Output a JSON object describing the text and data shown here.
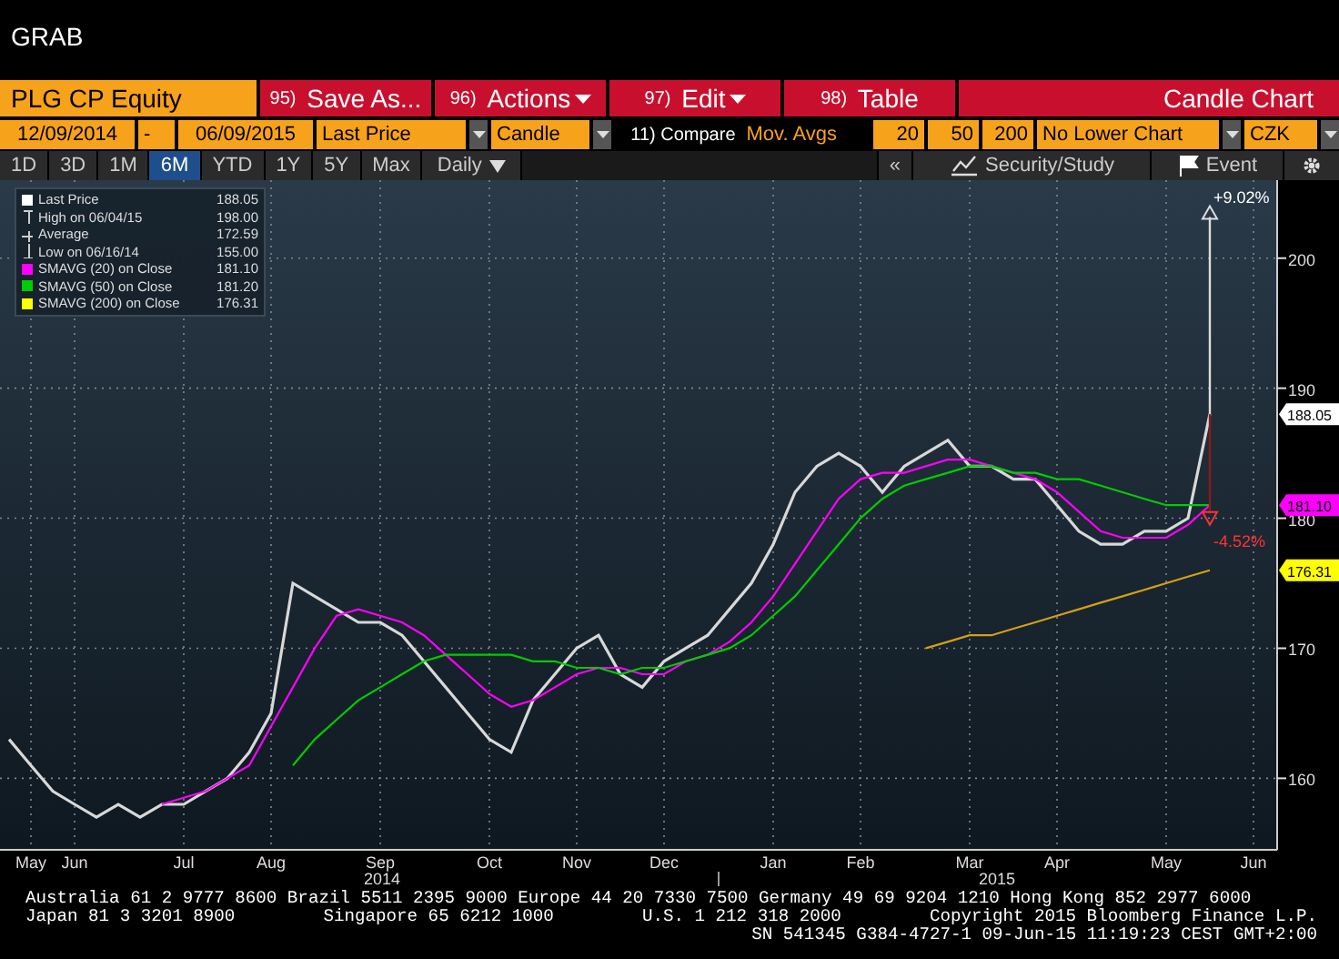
{
  "window": {
    "title": "GRAB"
  },
  "toolbar": {
    "security": "PLG CP Equity",
    "buttons": [
      {
        "number": "95)",
        "label": "Save As...",
        "dropdown": false
      },
      {
        "number": "96)",
        "label": "Actions",
        "dropdown": true
      },
      {
        "number": "97)",
        "label": "Edit",
        "dropdown": true
      },
      {
        "number": "98)",
        "label": "Table",
        "dropdown": false
      }
    ],
    "chart_type_title": "Candle Chart"
  },
  "settings": {
    "start_date": "12/09/2014",
    "separator": "-",
    "end_date": "06/09/2015",
    "field": "Last Price",
    "style": "Candle",
    "compare": "11) Compare",
    "mov_avgs_label": "Mov. Avgs",
    "mov_avgs": [
      "20",
      "50",
      "200"
    ],
    "lower_chart": "No Lower Chart",
    "currency": "CZK"
  },
  "periods": [
    {
      "label": "1D",
      "selected": false
    },
    {
      "label": "3D",
      "selected": false
    },
    {
      "label": "1M",
      "selected": false
    },
    {
      "label": "6M",
      "selected": true
    },
    {
      "label": "YTD",
      "selected": false
    },
    {
      "label": "1Y",
      "selected": false
    },
    {
      "label": "5Y",
      "selected": false
    },
    {
      "label": "Max",
      "selected": false
    }
  ],
  "frequency": "Daily",
  "right_tools": {
    "collapse": "«",
    "study": "Security/Study",
    "event": "Event"
  },
  "chart": {
    "legend": [
      {
        "kind": "square",
        "label": "Last Price",
        "value": "188.05",
        "color": "#ffffff"
      },
      {
        "kind": "high",
        "label": "High on 06/04/15",
        "value": "198.00"
      },
      {
        "kind": "average",
        "label": "Average",
        "value": "172.59"
      },
      {
        "kind": "low",
        "label": "Low on 06/16/14",
        "value": "155.00"
      },
      {
        "kind": "square",
        "label": "SMAVG (20) on Close",
        "value": "181.10",
        "color": "#ff00ff"
      },
      {
        "kind": "square",
        "label": "SMAVG (50) on Close",
        "value": "181.20",
        "color": "#00cc00"
      },
      {
        "kind": "square",
        "label": "SMAVG (200) on Close",
        "value": "176.31",
        "color": "#ffff00"
      }
    ],
    "year_labels": [
      "2014",
      "2015"
    ],
    "percent_labels": [
      {
        "text": "+9.02%",
        "color": "#ffffff"
      },
      {
        "text": "-4.52%",
        "color": "#ff3333"
      }
    ],
    "value_tags": [
      {
        "text": "188.05",
        "color": "#ffffff"
      },
      {
        "text": "181.10",
        "color": "#ff00ff"
      },
      {
        "text": "176.31",
        "color": "#ffff00"
      }
    ],
    "chart_data": {
      "type": "line",
      "categories": [
        null,
        "May",
        null,
        "Jun",
        null,
        null,
        null,
        null,
        "Jul",
        null,
        null,
        null,
        "Aug",
        null,
        null,
        null,
        null,
        "Sep",
        null,
        null,
        null,
        null,
        "Oct",
        null,
        null,
        null,
        "Nov",
        null,
        null,
        null,
        "Dec",
        null,
        null,
        null,
        null,
        "Jan",
        null,
        null,
        null,
        "Feb",
        null,
        null,
        null,
        null,
        "Mar",
        null,
        null,
        null,
        "Apr",
        null,
        null,
        null,
        null,
        "May",
        null,
        null,
        null,
        "Jun"
      ],
      "ylim": [
        154.5,
        206
      ],
      "grid": true,
      "yticks": [
        160,
        170,
        180,
        190,
        200
      ],
      "series": [
        {
          "color": "#d8d8d8",
          "values": [
            163,
            161,
            159,
            158,
            157,
            158,
            157,
            158,
            158,
            159,
            160,
            162,
            165,
            175,
            174,
            173,
            172,
            172,
            171,
            169,
            167,
            165,
            163,
            162,
            166,
            168,
            170,
            171,
            168,
            167,
            169,
            170,
            171,
            173,
            175,
            178,
            182,
            184,
            185,
            184,
            182,
            184,
            185,
            186,
            184,
            184,
            183,
            183,
            181,
            179,
            178,
            178,
            179,
            179,
            180,
            188,
            null,
            null
          ]
        },
        {
          "color": "#ff00ff",
          "values": [
            null,
            null,
            null,
            null,
            null,
            null,
            null,
            158,
            158.5,
            159,
            160,
            161,
            164,
            167,
            170,
            172.5,
            173,
            172.5,
            172,
            171,
            169.5,
            168,
            166.5,
            165.5,
            166,
            167,
            168,
            168.5,
            168.5,
            168,
            168,
            169,
            169.5,
            170.5,
            172,
            174,
            176.5,
            179,
            181.5,
            183,
            183.5,
            183.5,
            184,
            184.5,
            184.5,
            184,
            183.5,
            183,
            182,
            180.5,
            179,
            178.5,
            178.5,
            178.5,
            179.5,
            181,
            null,
            null
          ]
        },
        {
          "color": "#00cc00",
          "values": [
            null,
            null,
            null,
            null,
            null,
            null,
            null,
            null,
            null,
            null,
            null,
            null,
            null,
            161,
            163,
            164.5,
            166,
            167,
            168,
            169,
            169.5,
            169.5,
            169.5,
            169.5,
            169,
            169,
            168.5,
            168.5,
            168,
            168.5,
            168.5,
            169,
            169.5,
            170,
            171,
            172.5,
            174,
            176,
            178,
            180,
            181.5,
            182.5,
            183,
            183.5,
            184,
            184,
            183.5,
            183.5,
            183,
            183,
            182.5,
            182,
            181.5,
            181,
            181,
            181,
            null,
            null
          ]
        },
        {
          "color": "#d4a017",
          "values": [
            null,
            null,
            null,
            null,
            null,
            null,
            null,
            null,
            null,
            null,
            null,
            null,
            null,
            null,
            null,
            null,
            null,
            null,
            null,
            null,
            null,
            null,
            null,
            null,
            null,
            null,
            null,
            null,
            null,
            null,
            null,
            null,
            null,
            null,
            null,
            null,
            null,
            null,
            null,
            null,
            null,
            null,
            170,
            170.5,
            171,
            171,
            171.5,
            172,
            172.5,
            173,
            173.5,
            174,
            174.5,
            175,
            175.5,
            176,
            null,
            null
          ]
        }
      ]
    }
  },
  "footer": {
    "line_1": "Australia 61 2 9777 8600 Brazil 5511 2395 9000 Europe 44 20 7330 7500 Germany 49 69 9204 1210 Hong Kong 852 2977 6000",
    "line_2": [
      "Japan 81 3 3201 8900",
      "Singapore 65 6212 1000",
      "U.S. 1 212 318 2000",
      "Copyright 2015 Bloomberg Finance L.P."
    ],
    "line_3": "SN 541345 G384-4727-1 09-Jun-15 11:19:23 CEST GMT+2:00"
  }
}
